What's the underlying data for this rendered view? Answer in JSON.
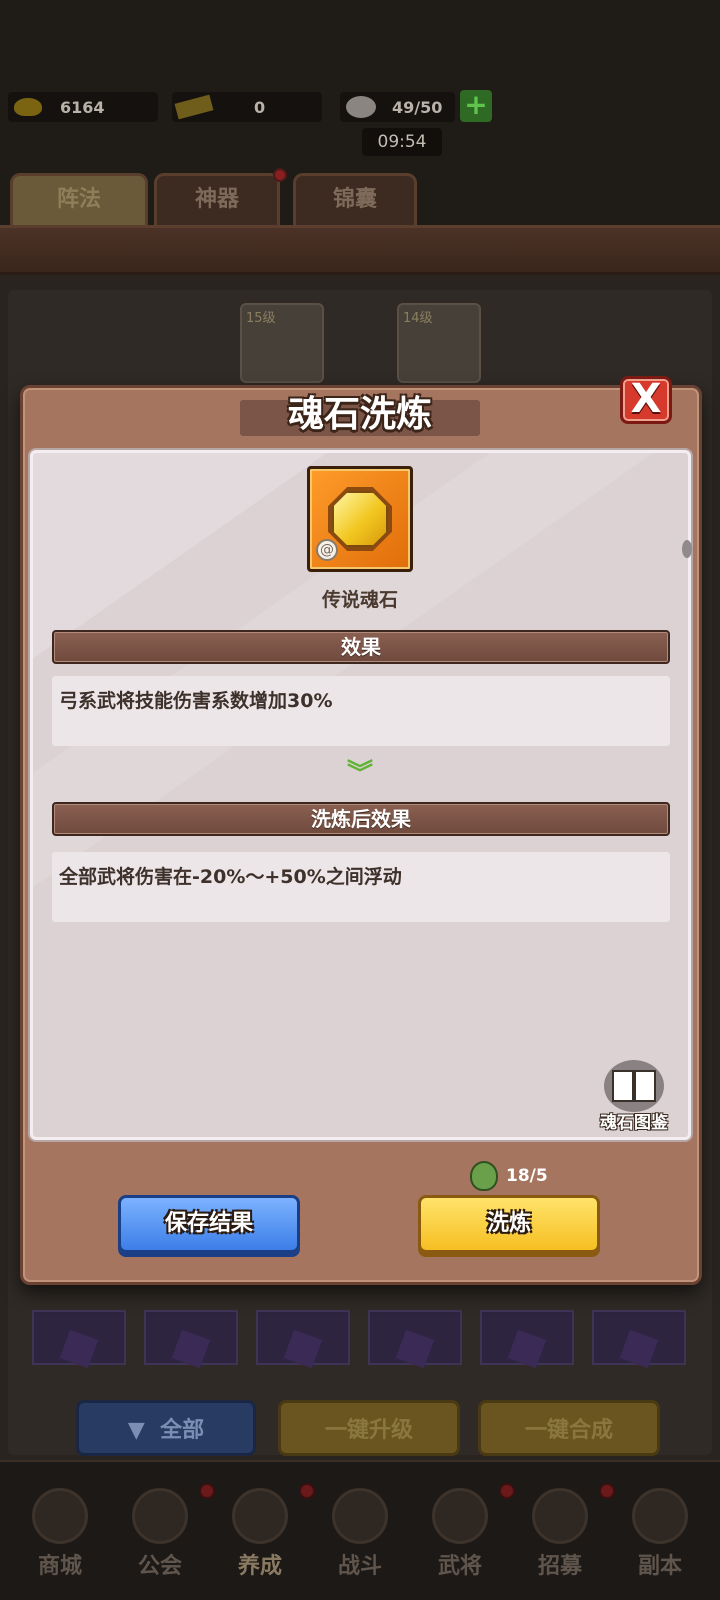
{
  "header": {
    "gold": "6164",
    "tickets": "0",
    "stamina": "49/50",
    "timer": "09:54"
  },
  "top_tabs": [
    "阵法",
    "神器",
    "锦囊"
  ],
  "hero_cards": [
    "15级",
    "14级"
  ],
  "modal": {
    "title": "魂石洗炼",
    "close_label": "X",
    "gem_name": "传说魂石",
    "effect_header": "效果",
    "effect_text": "弓系武将技能伤害系数增加30%",
    "after_header": "洗炼后效果",
    "after_text": "全部武将伤害在-20%～+50%之间浮动",
    "codex_label": "魂石图鉴",
    "cost": "18/5",
    "save_button": "保存结果",
    "refine_button": "洗炼"
  },
  "bottom_actions": {
    "filter": "全部",
    "upgrade_all": "一键升级",
    "merge_all": "一键合成"
  },
  "nav": [
    "商城",
    "公会",
    "养成",
    "战斗",
    "武将",
    "招募",
    "副本"
  ],
  "colors": {
    "modal_bg": "#a57560",
    "save_button": "#3d7fe8",
    "refine_button": "#f6bf22",
    "close_button": "#d63a2c",
    "gem_frame": "#e06d0a"
  }
}
